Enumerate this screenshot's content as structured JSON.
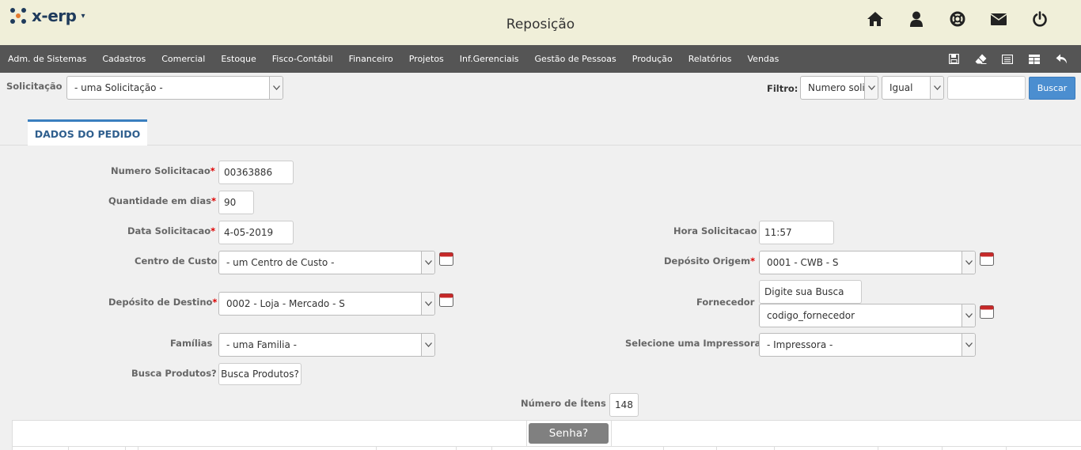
{
  "app": {
    "logo_text": "x-erp",
    "title": "Reposição",
    "brand_color": "#1f3b5c",
    "accent_color": "#e47a2e"
  },
  "top_icons": [
    "home-icon",
    "user-icon",
    "help-lifebuoy-icon",
    "mail-icon",
    "power-icon"
  ],
  "menu": {
    "items": [
      "Adm. de Sistemas",
      "Cadastros",
      "Comercial",
      "Estoque",
      "Fisco-Contábil",
      "Financeiro",
      "Projetos",
      "Inf.Gerenciais",
      "Gestão de Pessoas",
      "Produção",
      "Relatórios",
      "Vendas"
    ],
    "tools": [
      "save-icon",
      "eraser-icon",
      "list-icon",
      "table-icon",
      "back-arrow-icon"
    ]
  },
  "search": {
    "solicitacao_label": "Solicitação",
    "solicitacao_value": "- uma Solicitação -",
    "filtro_label": "Filtro:",
    "filter_field": "Numero soli",
    "filter_op": "Igual",
    "filter_value": "",
    "buscar": "Buscar"
  },
  "tab": {
    "label": "DADOS DO PEDIDO"
  },
  "form": {
    "numero_label": "Numero Solicitacao",
    "numero_value": "00363886",
    "quantidade_label": "Quantidade em dias",
    "quantidade_value": "90",
    "data_label": "Data Solicitacao",
    "data_value": "4-05-2019",
    "hora_label": "Hora Solicitacao",
    "hora_value": "11:57",
    "centro_label": "Centro de Custo",
    "centro_value": "- um Centro de Custo -",
    "origem_label": "Depósito Origem",
    "origem_value": "0001 - CWB - S",
    "destino_label": "Depósito de Destino",
    "destino_value": "0002 - Loja - Mercado - S",
    "fornecedor_label": "Fornecedor",
    "fornecedor_search": "Digite sua Busca",
    "fornecedor_value": "codigo_fornecedor",
    "familias_label": "Famílias",
    "familias_value": "- uma Familia -",
    "impressora_label": "Selecione uma Impressora",
    "impressora_value": "- Impressora -",
    "busca_label": "Busca Produtos?",
    "busca_button": "Busca Produtos?",
    "itens_label": "Número de Ítens",
    "itens_value": "148",
    "required_mark": "*"
  },
  "grid": {
    "senha_button": "Senha?"
  }
}
